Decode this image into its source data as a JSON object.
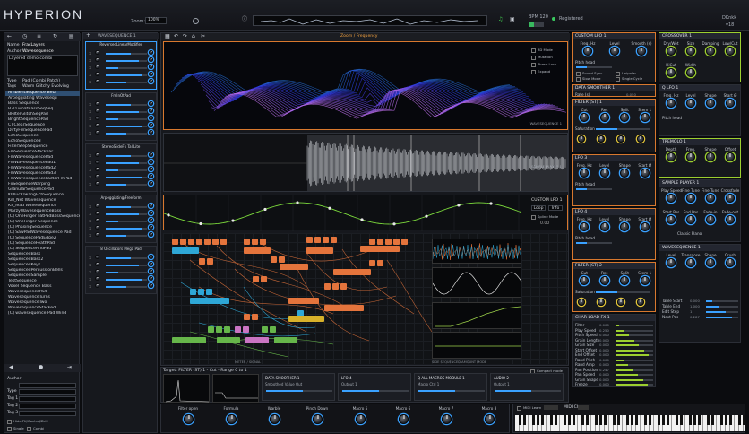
{
  "app": {
    "title": "HYPERION",
    "zoom_label": "Zoom:",
    "zoom_value": "100%",
    "bpm_label": "BPM 120",
    "registered": "Registered",
    "preset_name": "DKnkk",
    "preset_version": "v18"
  },
  "browser": {
    "name_label": "Name",
    "name_value": "FracLayers",
    "author_label": "Author",
    "author_value": "Wavesequence",
    "comment": "Layered demo combi",
    "type_label": "Type",
    "type_value": "Pad (Combi Patch)",
    "tags_label": "Tags",
    "tags_value": "Warm Glitchy Evolving",
    "items": [
      "AmbientSequence Beta",
      "Arpeggiating Wavesequ",
      "Bass Sequence",
      "B3D whatBassSeqSeq",
      "BFilterGlitchSeqPad",
      "BrightSequencePad",
      "C] ClearSequence",
      "DirtyFmSequencePad",
      "EchoSequence",
      "EchoSequence3",
      "FilterStepSequence",
      "FmSequenceStackbar",
      "FmWavesequencePad",
      "FmWavesequencePad1",
      "FmWavesequencePad2",
      "FmWavesequencePad3",
      "FmWavesequenceFactorFmPad",
      "FxSequenceWarping",
      "GranularSequencePad",
      "KIPluckTwangEchSequence",
      "Kill_Net Wavesequence",
      "KS_lead Wavesequence",
      "MarzyWavesequenceBass",
      "[C] OneFinger FatPadBassSequence",
      "[C] OneFinger Sequence",
      "[C] PhasingSequence",
      "[C] SawPadWavesequence Pad",
      "[C] SequencePadEdge2",
      "[C] SequenceFeathPad",
      "[C] SequenceAndPad",
      "SequencedBass",
      "SequencedBass2",
      "SequencedKeys",
      "SequencedPercussionBells",
      "SequencedSample",
      "TestSequence",
      "Voxel Sequence Bass",
      "WavesequencePad",
      "WavesequenceTurns",
      "WavesequenceTwo",
      "WavesequenceStacked",
      "[C] wavesequence Pad Wind"
    ],
    "author_filter": "Author",
    "type_filter": "Type",
    "tag1": "Tag 1",
    "tag2": "Tag 2",
    "tag3": "Tag 3",
    "hide_label": "Hide FX/Control/Drill",
    "single_label": "Single",
    "combi_label": "Combi"
  },
  "macros_panel": {
    "title": "WAVESEQUENCE 1",
    "modules": [
      {
        "title": "ReversedLinearModifier"
      },
      {
        "title": "FmInOtPad"
      },
      {
        "title": "StereoSlideFx Tal Lite"
      },
      {
        "title": "Arpeggiating/Freeform"
      },
      {
        "title": "8 Oscillators Mega Pad"
      }
    ]
  },
  "center": {
    "view_title": "Zoom / Frequency",
    "legend": [
      "3D Mode",
      "Mutation",
      "Phase Lock",
      "Expand"
    ],
    "wave1_label": "WAVESEQUENCE 1",
    "sample_label": "SAMPLE PLAYER 1",
    "lfo_label": "CUSTOM LFO 1",
    "loop_label": "Loop",
    "info_label": "Info",
    "spline_label": "Spline Mode",
    "spline_value": "0.00",
    "graph_footer_left": "METER / SIGNAL",
    "graph_footer_right": "SIDE SEQUENCED AMOUNT MODE"
  },
  "modules_col1": [
    {
      "title": "CUSTOM LFO 1",
      "labels": [
        "Freq. Hz",
        "Level",
        "Smooth (s)"
      ],
      "pitch": "Pitch head",
      "opts": [
        "Sound Sync",
        "Unipolar",
        "Slow Mode",
        "Single Cycle"
      ]
    },
    {
      "title": "DATA SMOOTHER 1",
      "rate": "Rate (s)",
      "rate_val": "0.050"
    },
    {
      "title": "FILTER (ST) 1",
      "labels": [
        "Cut",
        "Res",
        "Split",
        "Stem 1"
      ],
      "sub": "Saturation"
    },
    {
      "title": "LFO 3",
      "labels": [
        "Freq. Hz",
        "Level",
        "Shape",
        "Start Ø"
      ],
      "pitch": "Pitch head"
    },
    {
      "title": "LFO 4",
      "labels": [
        "Freq. Hz",
        "Level",
        "Shape",
        "Start Ø"
      ],
      "pitch": "Pitch head"
    },
    {
      "title": "FILTER (ST) 2",
      "labels": [
        "Cut",
        "Res",
        "Split",
        "Stem 1"
      ],
      "sub": "Saturation"
    },
    {
      "title": "CHAR LOAD FX 1",
      "rows": [
        [
          "Filter",
          "0.000"
        ],
        [
          "Play Speed",
          "0.250"
        ],
        [
          "Pitch Speed",
          "0.000"
        ],
        [
          "Grain Length",
          "0.000"
        ],
        [
          "Grain Size",
          "0.000"
        ],
        [
          "Start Offset",
          "0.000"
        ],
        [
          "End Offset",
          "0.000"
        ],
        [
          "Rand Pitch",
          "0.000"
        ],
        [
          "Rand Amp",
          "0.000"
        ],
        [
          "Pan Position",
          "0.247"
        ],
        [
          "Pan Speed",
          "0.000"
        ],
        [
          "Grain Shape",
          "0.000"
        ],
        [
          "Freeze",
          "0.000"
        ]
      ]
    }
  ],
  "modules_col2": [
    {
      "title": "CROSSOVER 1",
      "labels": [
        "Dry/Wet",
        "Size",
        "Damping",
        "Low/Cut",
        "HiCut",
        "Width"
      ]
    },
    {
      "title": "Q LFO 1",
      "labels": [
        "Freq. Hz",
        "Level",
        "Shape",
        "Start Ø"
      ],
      "pitch": "Pitch head"
    },
    {
      "title": "TREMOLO 1",
      "labels": [
        "Depth",
        "Freq.",
        "Shape",
        "Offset"
      ]
    },
    {
      "title": "SAMPLE PLAYER 1",
      "labels": [
        "Play Speed",
        "Fine Tune",
        "Fine Tune",
        "Crossfade",
        "Start Pos",
        "End Pos",
        "Fade-in",
        "Fade-out"
      ],
      "sample": "Classic Piano"
    },
    {
      "title": "WAVESEQUENCE 1",
      "labels": [
        "Level",
        "Transpose",
        "Shape",
        "Crush"
      ],
      "rows": [
        [
          "Table Start",
          "0.000"
        ],
        [
          "Table End",
          "1.000"
        ],
        [
          "Edit Step",
          "1"
        ],
        [
          "Next Pos",
          "0.287"
        ]
      ]
    }
  ],
  "bottom": {
    "target_label": "Target: FILTER (ST) 1 - Cut - Range 0 to 1",
    "compact": "Compact mode",
    "mods": [
      {
        "title": "DATA SMOOTHER 1",
        "sub": "Smoothed Value Out"
      },
      {
        "title": "LFO 4",
        "sub": "Output 1"
      },
      {
        "title": "Q ALL MACROS MODULE 1",
        "sub": "Macro Ctrl 1"
      },
      {
        "title": "AUDIO 2",
        "sub": "Output 1"
      }
    ],
    "macros": [
      "Filter open",
      "Formula",
      "Warble",
      "Pinch Down",
      "Macro 5",
      "Macro 6",
      "Macro 7",
      "Macro 8"
    ],
    "midi_learn": "MIDI Learn",
    "midi_ch": "MIDI Ch"
  }
}
